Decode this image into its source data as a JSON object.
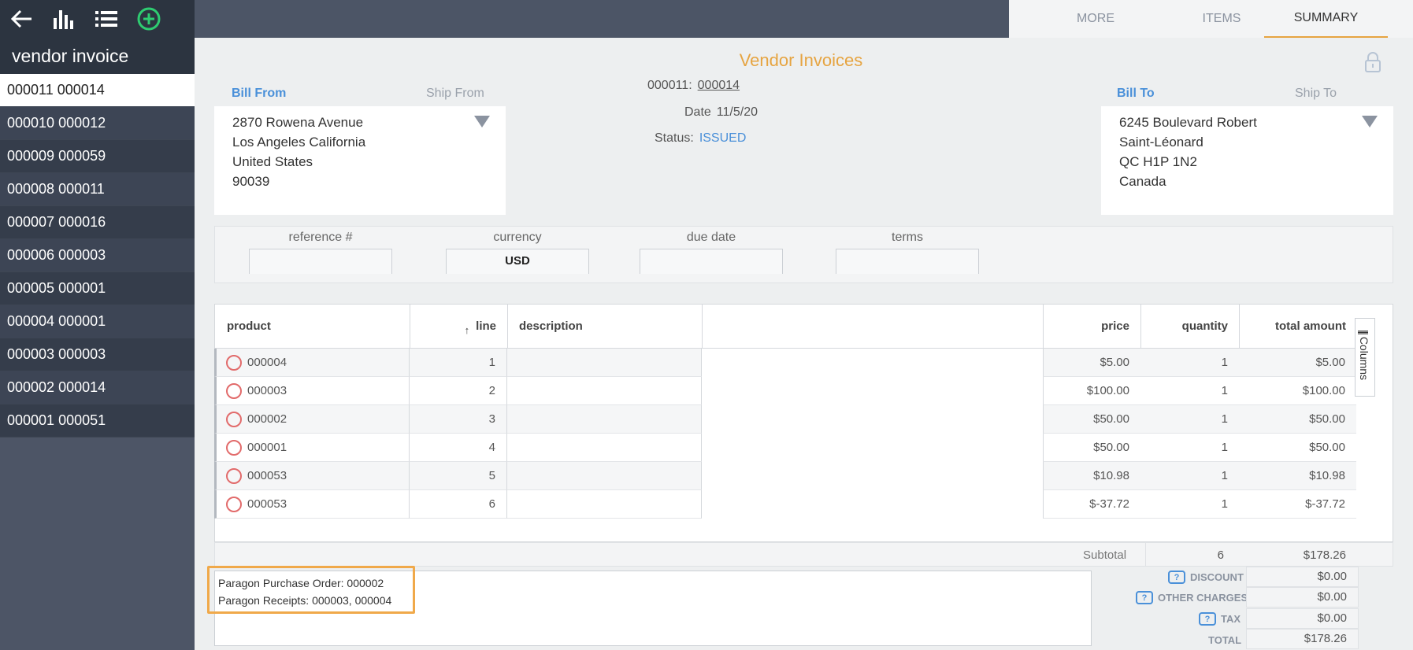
{
  "topbar": {
    "icons": [
      "back-arrow-icon",
      "bar-chart-icon",
      "list-icon",
      "add-circle-icon"
    ],
    "tabs": [
      {
        "label": "MORE"
      },
      {
        "label": "ITEMS"
      },
      {
        "label": "SUMMARY",
        "active": true
      }
    ]
  },
  "sidebar": {
    "title": "vendor invoice",
    "items": [
      {
        "label": "000011 000014",
        "selected": true
      },
      {
        "label": "000010 000012"
      },
      {
        "label": "000009 000059"
      },
      {
        "label": "000008 000011"
      },
      {
        "label": "000007 000016"
      },
      {
        "label": "000006 000003"
      },
      {
        "label": "000005 000001"
      },
      {
        "label": "000004 000001"
      },
      {
        "label": "000003 000003"
      },
      {
        "label": "000002 000014"
      },
      {
        "label": "000001 000051"
      }
    ]
  },
  "header": {
    "title": "Vendor Invoices",
    "bill_from_label": "Bill From",
    "ship_from_label": "Ship From",
    "bill_to_label": "Bill To",
    "ship_to_label": "Ship To",
    "bill_from": [
      "2870 Rowena Avenue",
      "Los Angeles California",
      "United States",
      "90039"
    ],
    "bill_to": [
      "6245 Boulevard Robert",
      "Saint-Léonard",
      "QC H1P 1N2",
      "Canada"
    ],
    "number_label": "000011:",
    "number_value": "000014",
    "date_label": "Date",
    "date_value": "11/5/20",
    "status_label": "Status:",
    "status_value": "ISSUED"
  },
  "fields": {
    "reference_label": "reference #",
    "reference_value": "",
    "currency_label": "currency",
    "currency_value": "USD",
    "due_date_label": "due date",
    "due_date_value": "",
    "terms_label": "terms",
    "terms_value": ""
  },
  "table": {
    "columns": {
      "product": "product",
      "line": "line",
      "description": "description",
      "price": "price",
      "quantity": "quantity",
      "total": "total amount"
    },
    "columns_tab": "Columns",
    "rows": [
      {
        "product": "000004",
        "line": "1",
        "description": "",
        "price": "$5.00",
        "quantity": "1",
        "total": "$5.00"
      },
      {
        "product": "000003",
        "line": "2",
        "description": "",
        "price": "$100.00",
        "quantity": "1",
        "total": "$100.00"
      },
      {
        "product": "000002",
        "line": "3",
        "description": "",
        "price": "$50.00",
        "quantity": "1",
        "total": "$50.00"
      },
      {
        "product": "000001",
        "line": "4",
        "description": "",
        "price": "$50.00",
        "quantity": "1",
        "total": "$50.00"
      },
      {
        "product": "000053",
        "line": "5",
        "description": "",
        "price": "$10.98",
        "quantity": "1",
        "total": "$10.98"
      },
      {
        "product": "000053",
        "line": "6",
        "description": "",
        "price": "$-37.72",
        "quantity": "1",
        "total": "$-37.72"
      }
    ]
  },
  "totals": {
    "subtotal_label": "Subtotal",
    "subtotal_qty": "6",
    "subtotal_amount": "$178.26",
    "discount_label": "DISCOUNT",
    "discount_value": "$0.00",
    "other_label": "OTHER CHARGES",
    "other_value": "$0.00",
    "tax_label": "TAX",
    "tax_value": "$0.00",
    "total_label": "TOTAL",
    "total_value": "$178.26",
    "help_glyph": "?"
  },
  "notes": {
    "line1": "Paragon Purchase Order: 000002",
    "line2": "Paragon Receipts: 000003, 000004"
  },
  "colors": {
    "accent": "#e6a441",
    "link": "#4a90d9",
    "add": "#2ecc71",
    "error_circle": "#e26b6b"
  }
}
